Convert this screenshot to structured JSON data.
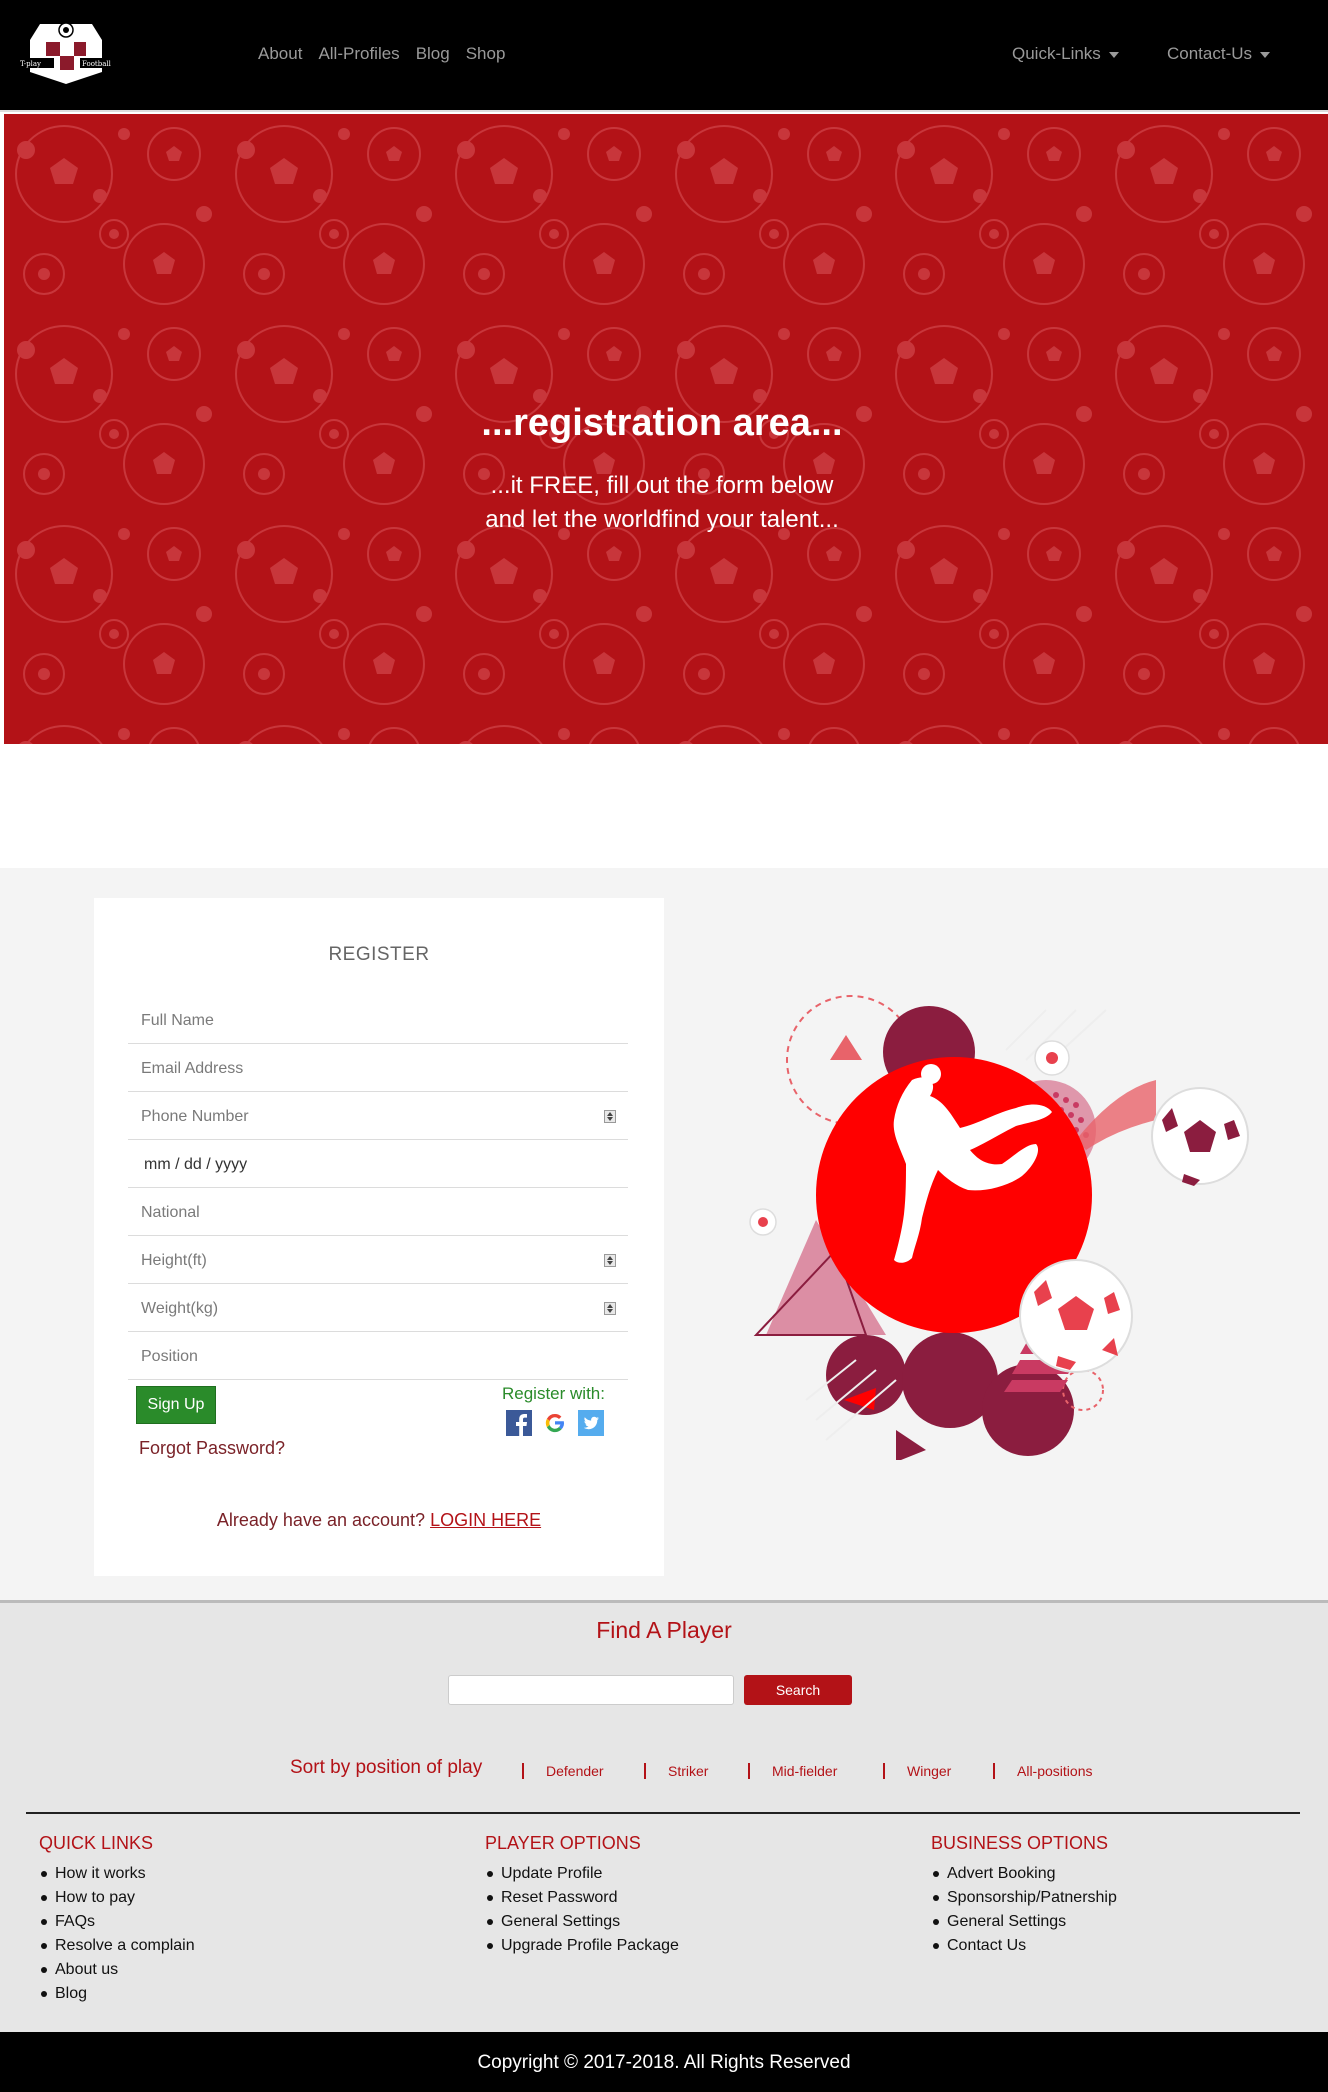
{
  "nav": {
    "logo_text_left": "T-play",
    "logo_text_right": "Football",
    "links": [
      "About",
      "All-Profiles",
      "Blog",
      "Shop"
    ],
    "quick_links": "Quick-Links",
    "contact_us": "Contact-Us"
  },
  "hero": {
    "title": "...registration area...",
    "subtitle_line1": "...it FREE, fill out the form below",
    "subtitle_line2": "and let the worldfind your talent..."
  },
  "register": {
    "title": "REGISTER",
    "fields": {
      "full_name": "Full Name",
      "email": "Email Address",
      "phone": "Phone Number",
      "date": "mm / dd / yyyy",
      "national": "National",
      "height": "Height(ft)",
      "weight": "Weight(kg)",
      "position": "Position"
    },
    "signup_label": "Sign Up",
    "forgot_label": "Forgot Password?",
    "register_with": "Register with:",
    "social_icons": [
      "facebook-icon",
      "google-icon",
      "twitter-icon"
    ],
    "already_text": "Already have an account?",
    "login_label": "LOGIN HERE"
  },
  "find": {
    "title": "Find A Player",
    "search_value": "",
    "search_label": "Search",
    "sort_label": "Sort by position of play",
    "positions": [
      "Defender",
      "Striker",
      "Mid-fielder",
      "Winger",
      "All-positions"
    ]
  },
  "footer": {
    "quick_links": {
      "title": "QUICK LINKS",
      "items": [
        "How it works",
        "How to pay",
        "FAQs",
        "Resolve a complain",
        "About us",
        "Blog"
      ]
    },
    "player_options": {
      "title": "PLAYER OPTIONS",
      "items": [
        "Update Profile",
        "Reset Password",
        "General Settings",
        "Upgrade Profile Package"
      ]
    },
    "business_options": {
      "title": "BUSINESS OPTIONS",
      "items": [
        "Advert Booking",
        "Sponsorship/Patnership",
        "General Settings",
        "Contact Us"
      ]
    },
    "copyright": "Copyright © 2017-2018. All Rights Reserved"
  },
  "colors": {
    "brand_red": "#b31217",
    "signup_green": "#2a8b2a",
    "nav_bg": "#000000",
    "link_gray": "#9a9a9a"
  }
}
